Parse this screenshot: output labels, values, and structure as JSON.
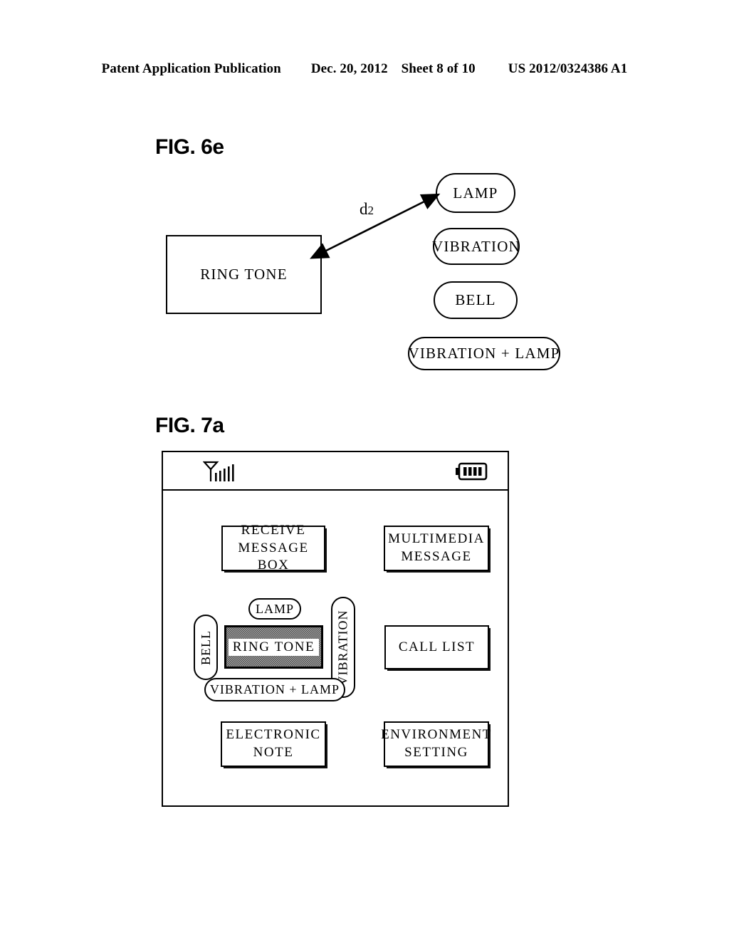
{
  "header": {
    "publication": "Patent Application Publication",
    "date": "Dec. 20, 2012",
    "sheet": "Sheet 8 of 10",
    "patent_number": "US 2012/0324386 A1"
  },
  "fig6e": {
    "label": "FIG. 6e",
    "source_box": "RING TONE",
    "distance_label": "d",
    "distance_subscript": "2",
    "options": [
      {
        "label": "LAMP"
      },
      {
        "label": "VIBRATION"
      },
      {
        "label": "BELL"
      },
      {
        "label": "VIBRATION + LAMP"
      }
    ]
  },
  "fig7a": {
    "label": "FIG. 7a",
    "statusbar": {
      "signal_icon": "antenna-signal-bars-icon",
      "battery_icon": "battery-full-icon",
      "signal_bars": 5,
      "battery_segments": 4
    },
    "menu_items": [
      {
        "id": "receive-message-box",
        "line1": "RECEIVE",
        "line2": "MESSAGE BOX"
      },
      {
        "id": "multimedia-message",
        "line1": "MULTIMEDIA",
        "line2": "MESSAGE"
      },
      {
        "id": "call-list",
        "line1": "CALL LIST",
        "line2": ""
      },
      {
        "id": "electronic-note",
        "line1": "ELECTRONIC",
        "line2": "NOTE"
      },
      {
        "id": "environment-setting",
        "line1": "ENVIRONMENT",
        "line2": "SETTING"
      }
    ],
    "center": {
      "selected": "RING TONE",
      "top_option": "LAMP",
      "left_option": "BELL",
      "right_option": "VIBRATION",
      "bottom_option": "VIBRATION + LAMP"
    }
  }
}
